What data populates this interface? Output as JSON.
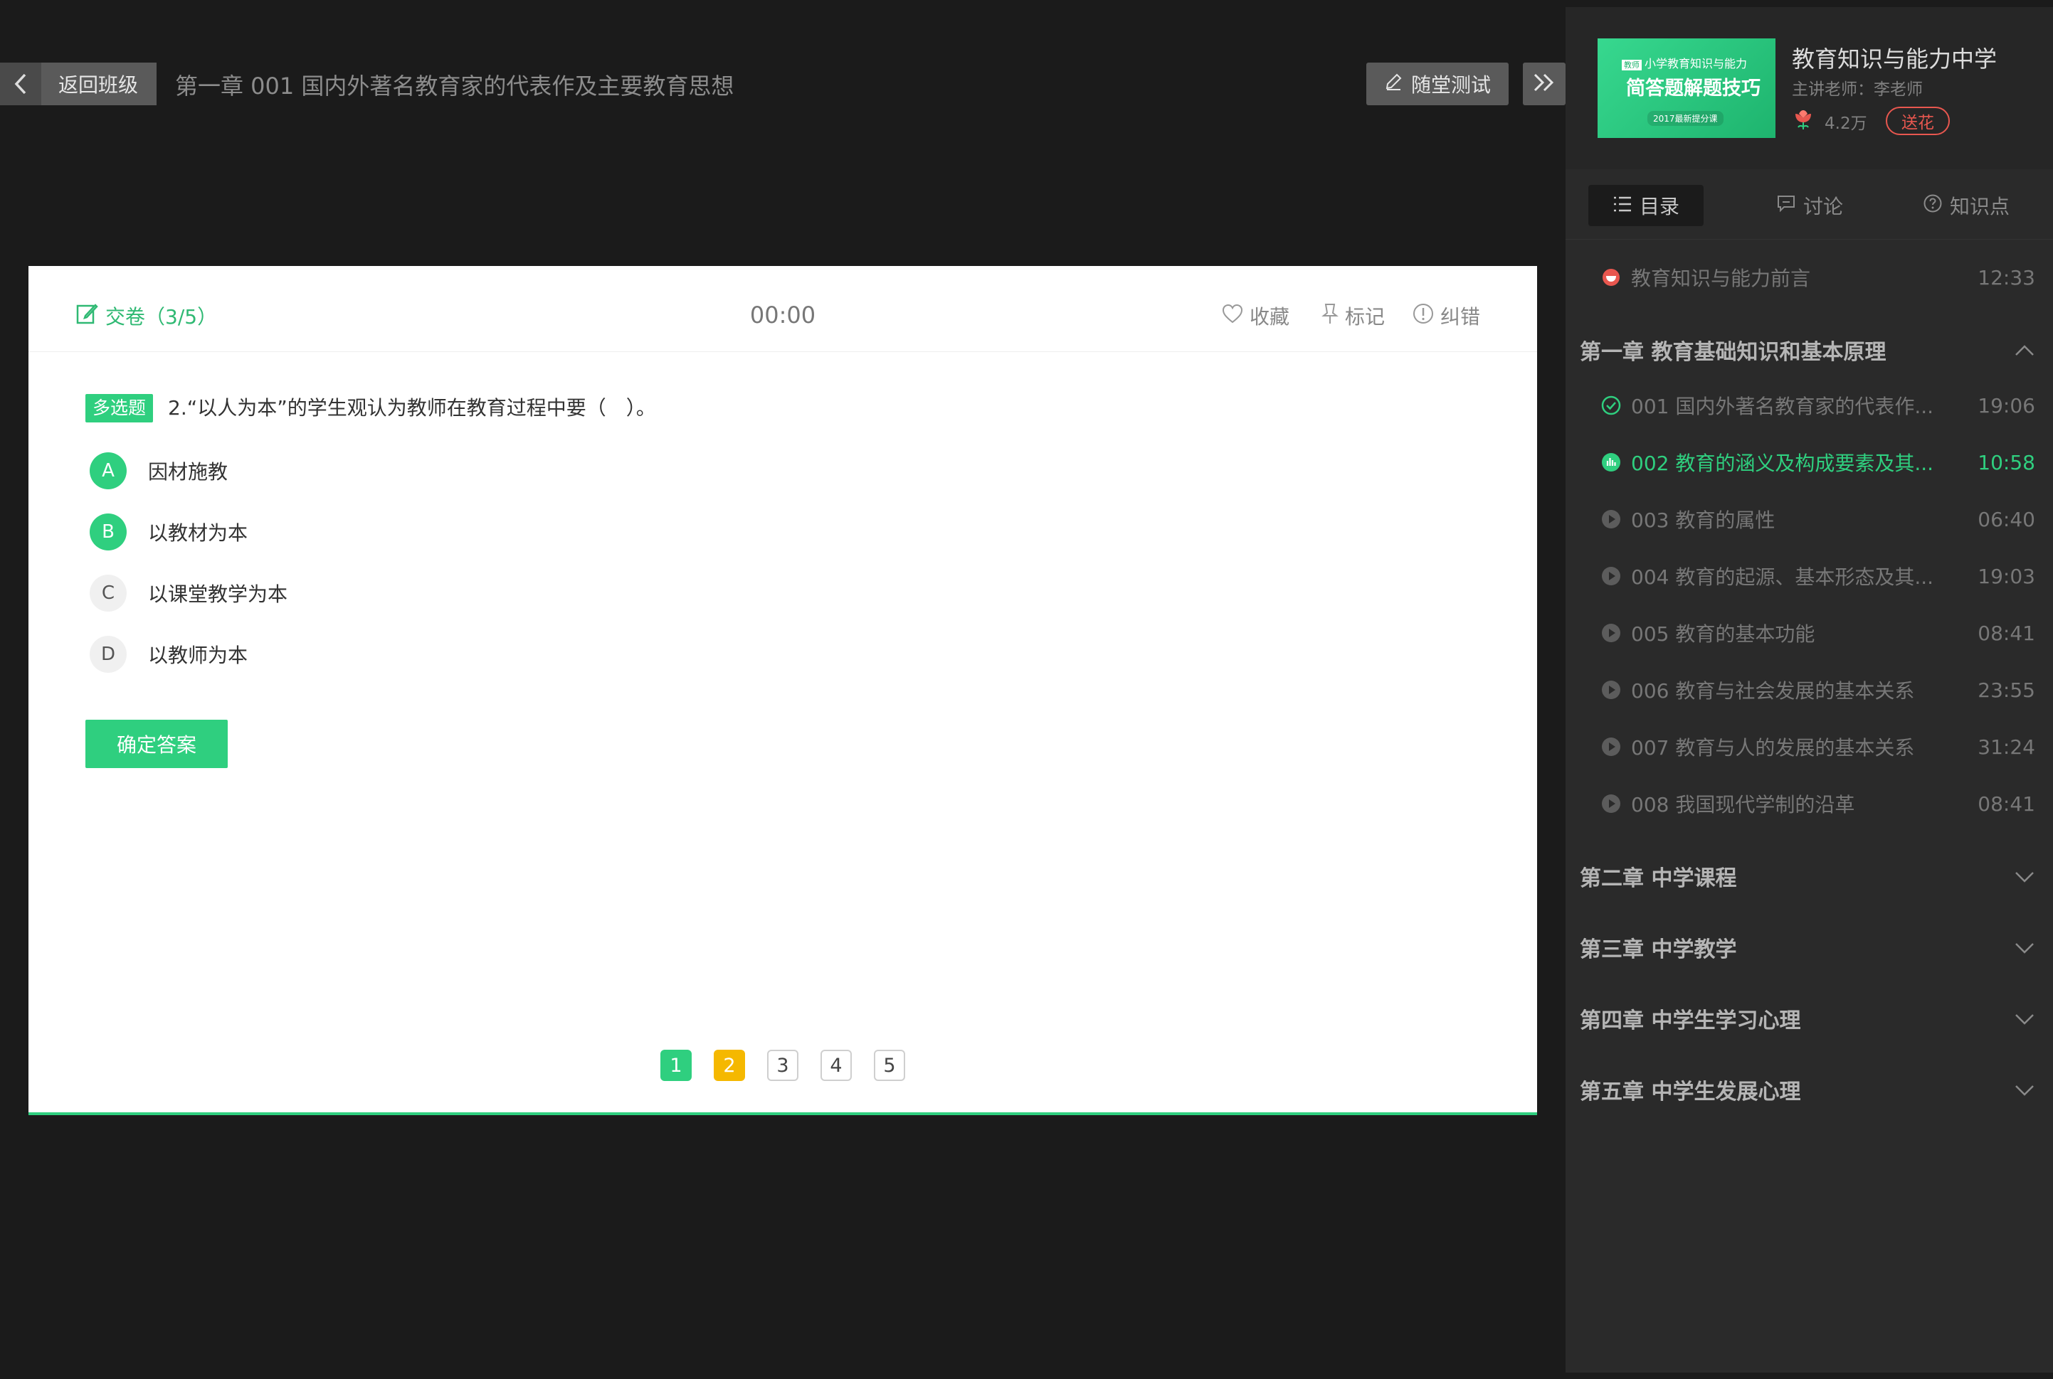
{
  "topbar": {
    "back_label": "返回班级",
    "title": "第一章  001 国内外著名教育家的代表作及主要教育思想",
    "test_label": "随堂测试"
  },
  "quiz": {
    "submit_label": "交卷（3/5）",
    "timer": "00:00",
    "actions": {
      "favorite": "收藏",
      "mark": "标记",
      "report": "纠错"
    },
    "question_type": "多选题",
    "question_text": "2.“以人为本”的学生观认为教师在教育过程中要（　）。",
    "options": [
      {
        "letter": "A",
        "text": "因材施教",
        "selected": true
      },
      {
        "letter": "B",
        "text": "以教材为本",
        "selected": true
      },
      {
        "letter": "C",
        "text": "以课堂教学为本",
        "selected": false
      },
      {
        "letter": "D",
        "text": "以教师为本",
        "selected": false
      }
    ],
    "confirm_label": "确定答案",
    "pages": [
      {
        "num": "1",
        "state": "done"
      },
      {
        "num": "2",
        "state": "current"
      },
      {
        "num": "3",
        "state": "todo"
      },
      {
        "num": "4",
        "state": "todo"
      },
      {
        "num": "5",
        "state": "todo"
      }
    ]
  },
  "course": {
    "thumb_tag": "教师",
    "thumb_line1": "小学教育知识与能力",
    "thumb_line2": "简答题解题技巧",
    "thumb_line3": "2017最新提分课",
    "title": "教育知识与能力中学",
    "teacher": "主讲老师：李老师",
    "flower_count": "4.2万",
    "send_flower": "送花"
  },
  "tabs": {
    "toc": "目录",
    "discuss": "讨论",
    "points": "知识点"
  },
  "toc": {
    "intro": {
      "title": "教育知识与能力前言",
      "duration": "12:33"
    },
    "chapter1": "第一章  教育基础知识和基本原理",
    "lessons": [
      {
        "title": "001 国内外著名教育家的代表作...",
        "duration": "19:06",
        "state": "done"
      },
      {
        "title": "002 教育的涵义及构成要素及其...",
        "duration": "10:58",
        "state": "playing"
      },
      {
        "title": "003 教育的属性",
        "duration": "06:40",
        "state": "normal"
      },
      {
        "title": "004 教育的起源、基本形态及其...",
        "duration": "19:03",
        "state": "normal"
      },
      {
        "title": "005 教育的基本功能",
        "duration": "08:41",
        "state": "normal"
      },
      {
        "title": "006 教育与社会发展的基本关系",
        "duration": "23:55",
        "state": "normal"
      },
      {
        "title": "007 教育与人的发展的基本关系",
        "duration": "31:24",
        "state": "normal"
      },
      {
        "title": "008 我国现代学制的沿革",
        "duration": "08:41",
        "state": "normal"
      }
    ],
    "chapters": [
      "第二章  中学课程",
      "第三章  中学教学",
      "第四章  中学生学习心理",
      "第五章  中学生发展心理"
    ]
  }
}
